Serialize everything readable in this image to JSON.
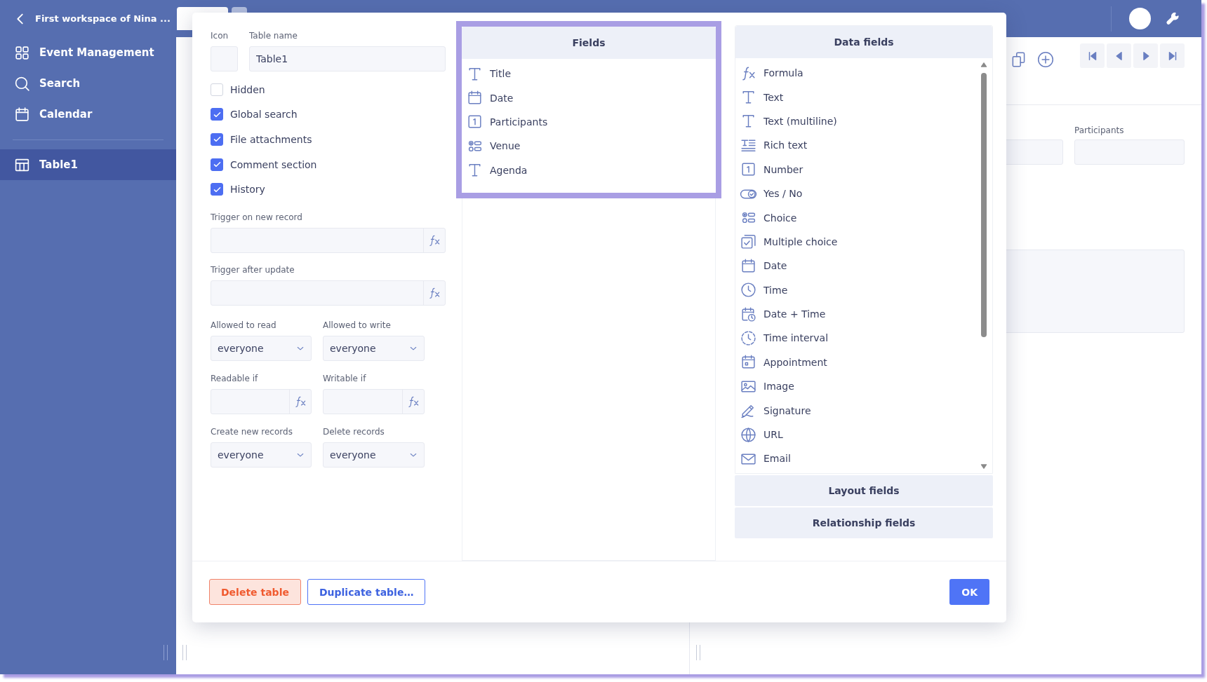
{
  "workspace": {
    "title": "First workspace of Nina ..."
  },
  "sidebar": {
    "items": [
      {
        "label": "Event Management",
        "kind": "apps",
        "selected": false
      },
      {
        "label": "Search",
        "kind": "search",
        "selected": false
      },
      {
        "label": "Calendar",
        "kind": "calendar",
        "selected": false
      }
    ],
    "tables": [
      {
        "label": "Table1",
        "selected": true
      }
    ]
  },
  "record": {
    "field_label": "Participants"
  },
  "dialog": {
    "icon_label": "Icon",
    "table_name_label": "Table name",
    "table_name": "Table1",
    "options": [
      {
        "label": "Hidden",
        "checked": false
      },
      {
        "label": "Global search",
        "checked": true
      },
      {
        "label": "File attachments",
        "checked": true
      },
      {
        "label": "Comment section",
        "checked": true
      },
      {
        "label": "History",
        "checked": true
      }
    ],
    "triggers": [
      {
        "label": "Trigger on new record"
      },
      {
        "label": "Trigger after update"
      }
    ],
    "permissions": [
      {
        "label": "Allowed to read",
        "kind": "select",
        "value": "everyone"
      },
      {
        "label": "Allowed to write",
        "kind": "select",
        "value": "everyone"
      },
      {
        "label": "Readable if",
        "kind": "formula"
      },
      {
        "label": "Writable if",
        "kind": "formula"
      },
      {
        "label": "Create new records",
        "kind": "select",
        "value": "everyone"
      },
      {
        "label": "Delete records",
        "kind": "select",
        "value": "everyone"
      }
    ],
    "fields": {
      "title": "Fields",
      "highlighted": true,
      "items": [
        {
          "label": "Title",
          "kind": "text"
        },
        {
          "label": "Date",
          "kind": "date"
        },
        {
          "label": "Participants",
          "kind": "number"
        },
        {
          "label": "Venue",
          "kind": "choice"
        },
        {
          "label": "Agenda",
          "kind": "text"
        }
      ]
    },
    "data_fields": {
      "title": "Data fields",
      "items": [
        {
          "label": "Formula",
          "kind": "formula"
        },
        {
          "label": "Text",
          "kind": "text"
        },
        {
          "label": "Text (multiline)",
          "kind": "text"
        },
        {
          "label": "Rich text",
          "kind": "rich"
        },
        {
          "label": "Number",
          "kind": "number"
        },
        {
          "label": "Yes / No",
          "kind": "yesno"
        },
        {
          "label": "Choice",
          "kind": "choice"
        },
        {
          "label": "Multiple choice",
          "kind": "multi"
        },
        {
          "label": "Date",
          "kind": "date"
        },
        {
          "label": "Time",
          "kind": "time"
        },
        {
          "label": "Date + Time",
          "kind": "datetime"
        },
        {
          "label": "Time interval",
          "kind": "interval"
        },
        {
          "label": "Appointment",
          "kind": "appointment"
        },
        {
          "label": "Image",
          "kind": "image"
        },
        {
          "label": "Signature",
          "kind": "signature"
        },
        {
          "label": "URL",
          "kind": "url"
        },
        {
          "label": "Email",
          "kind": "email"
        }
      ]
    },
    "sections": [
      {
        "label": "Layout fields"
      },
      {
        "label": "Relationship fields"
      }
    ],
    "buttons": [
      {
        "label": "Delete table",
        "kind": "danger"
      },
      {
        "label": "Duplicate table…",
        "kind": "outline"
      },
      {
        "label": "OK",
        "kind": "primary"
      }
    ]
  }
}
